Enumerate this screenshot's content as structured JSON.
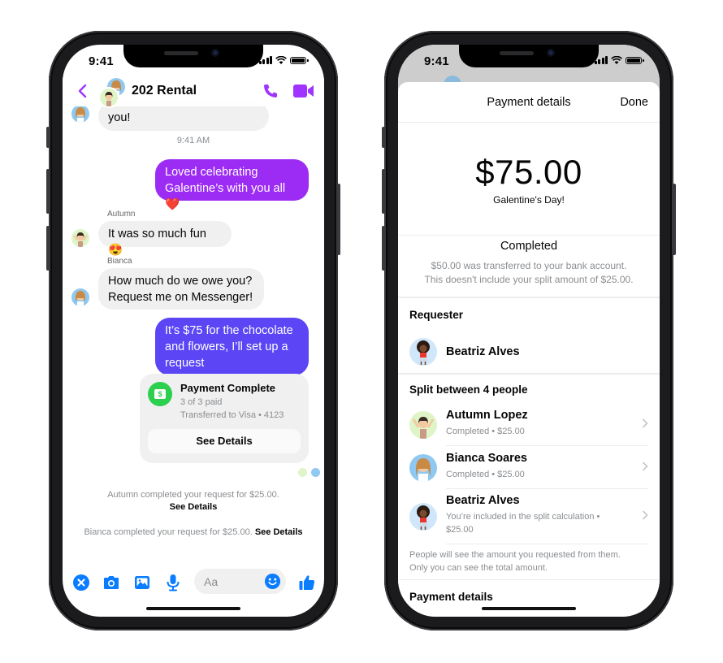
{
  "status_bar": {
    "time": "9:41"
  },
  "chat": {
    "title": "202 Rental",
    "colors": {
      "accent": "#a033ff",
      "outgoing_purple": "#9c2cf3",
      "outgoing_indigo": "#5b45f5",
      "messenger_blue": "#0a7cff",
      "success_green": "#2ccf4e"
    },
    "partial_message": "you!",
    "timestamp": "9:41 AM",
    "messages": [
      {
        "from": "me",
        "text": "Loved celebrating Galentine’s with you all ❤️"
      },
      {
        "from": "Autumn",
        "sender_label": "Autumn",
        "text": "It was so much fun 😍"
      },
      {
        "from": "Bianca",
        "sender_label": "Bianca",
        "text": "How much do we owe you? Request me on Messenger!"
      },
      {
        "from": "me",
        "text": "It’s $75 for the chocolate and flowers, I’ll set up a request"
      }
    ],
    "payment_card": {
      "icon": "dollar-bill-icon",
      "title": "Payment Complete",
      "paid": "3 of 3 paid",
      "transfer": "Transferred to Visa • 4123",
      "button": "See Details"
    },
    "system_messages": [
      {
        "text": "Autumn completed your request for $25.00.",
        "link": "See Details"
      },
      {
        "text": "Bianca completed your request for $25.00.",
        "link": "See Details"
      }
    ],
    "composer": {
      "placeholder": "Aa",
      "icons": [
        "close-circle-icon",
        "camera-icon",
        "photo-icon",
        "microphone-icon",
        "emoji-icon",
        "thumbs-up-icon"
      ]
    }
  },
  "payment_details": {
    "title": "Payment details",
    "done": "Done",
    "amount": "$75.00",
    "memo": "Galentine's Day!",
    "status": "Completed",
    "status_note_line1": "$50.00 was transferred to your bank account.",
    "status_note_line2": "This doesn't include your split amount of $25.00.",
    "requester_title": "Requester",
    "requester": {
      "name": "Beatriz Alves"
    },
    "split_title": "Split between 4 people",
    "split": [
      {
        "name": "Autumn Lopez",
        "status": "Completed • $25.00"
      },
      {
        "name": "Bianca Soares",
        "status": "Completed • $25.00"
      },
      {
        "name": "Beatriz Alves",
        "status_line1": "You’re included in the split calculation •",
        "status_line2": "$25.00"
      }
    ],
    "footnote_line1": "People will see the amount you requested from them.",
    "footnote_line2": "Only you can see the total amount.",
    "payment_details_title": "Payment details"
  }
}
